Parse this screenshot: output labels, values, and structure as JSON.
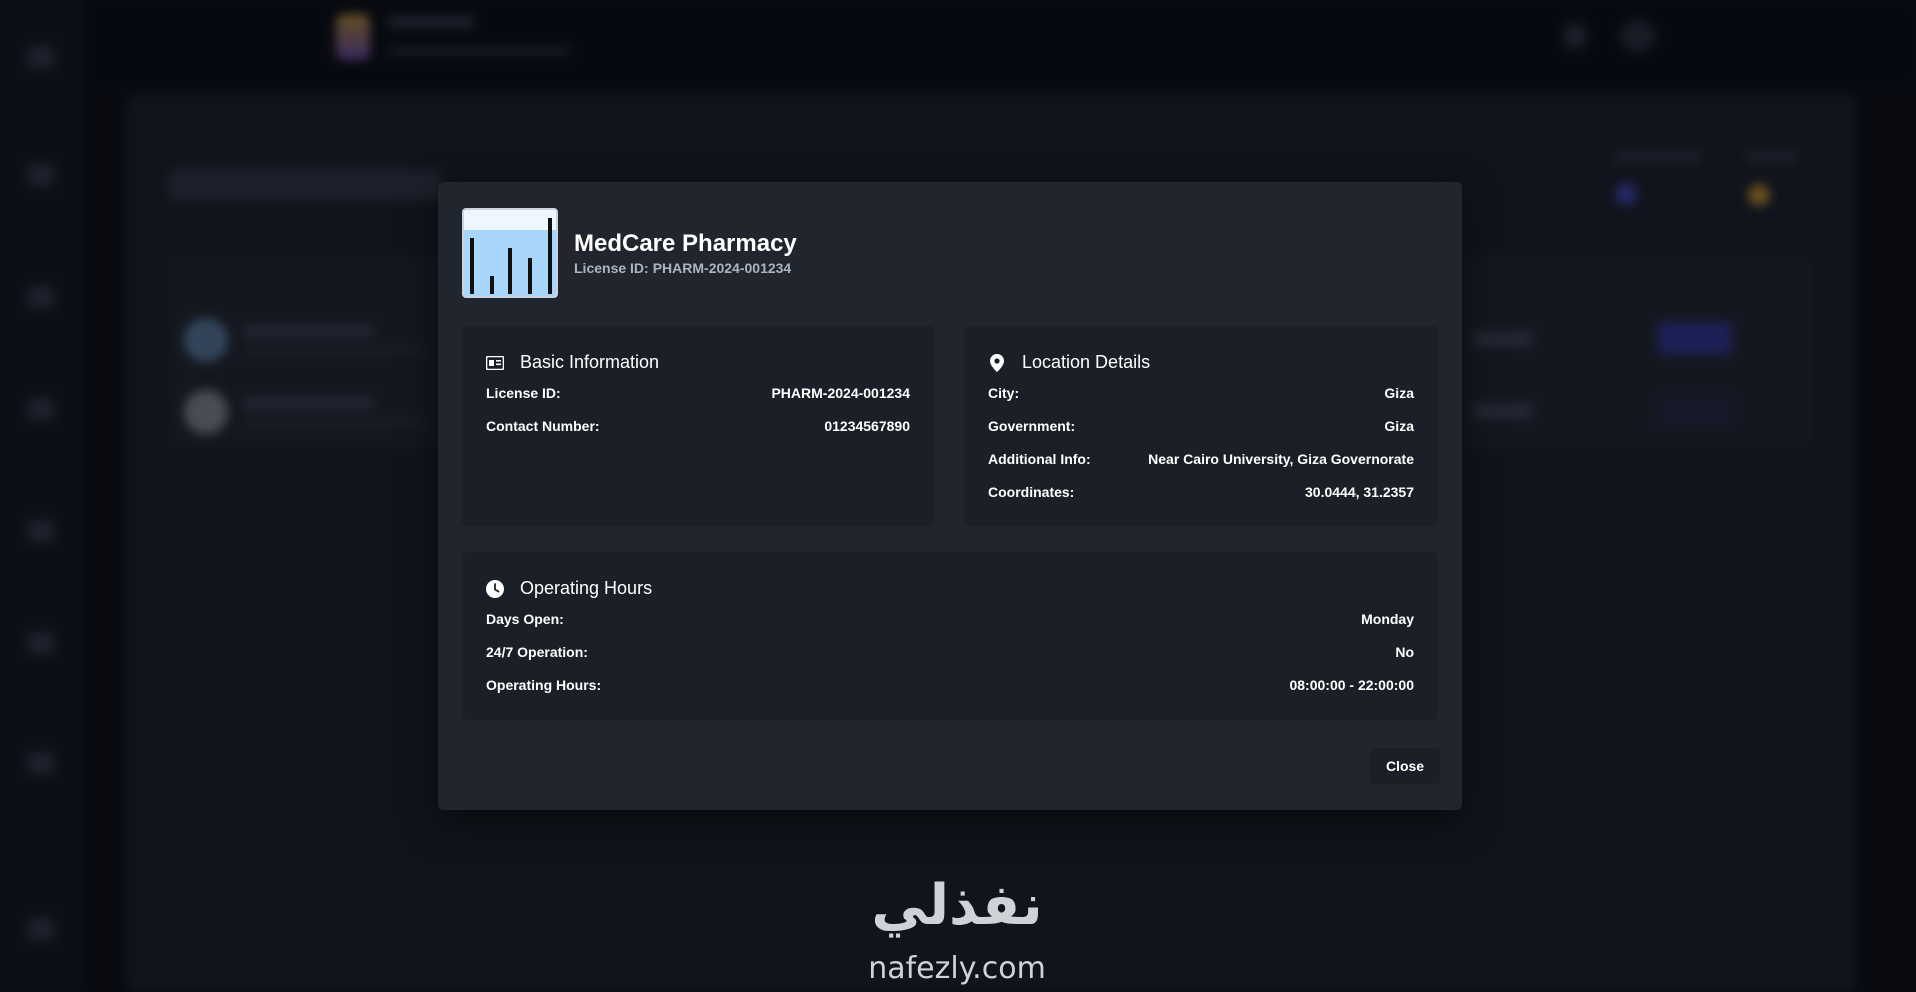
{
  "modal": {
    "pharmacy_name": "MedCare Pharmacy",
    "license_label": "License ID:",
    "license_value": "PHARM-2024-001234",
    "basic_info": {
      "title": "Basic Information",
      "icon": "id-card-icon",
      "rows": [
        {
          "label": "License ID:",
          "value": "PHARM-2024-001234"
        },
        {
          "label": "Contact Number:",
          "value": "01234567890"
        }
      ]
    },
    "location": {
      "title": "Location Details",
      "icon": "map-pin-icon",
      "rows": [
        {
          "label": "City:",
          "value": "Giza"
        },
        {
          "label": "Government:",
          "value": "Giza"
        },
        {
          "label": "Additional Info:",
          "value": "Near Cairo University, Giza Governorate"
        },
        {
          "label": "Coordinates:",
          "value": "30.0444, 31.2357"
        }
      ]
    },
    "hours": {
      "title": "Operating Hours",
      "icon": "clock-icon",
      "rows": [
        {
          "label": "Days Open:",
          "value": "Monday"
        },
        {
          "label": "24/7 Operation:",
          "value": "No"
        },
        {
          "label": "Operating Hours:",
          "value": "08:00:00 - 22:00:00"
        }
      ]
    },
    "close_label": "Close"
  },
  "watermark": {
    "arabic": "نفذلي",
    "latin": "nafezly.com"
  },
  "colors": {
    "modal_bg": "#20252e",
    "section_bg": "#1b1f27",
    "logo_fill": "#a8d6fb"
  }
}
